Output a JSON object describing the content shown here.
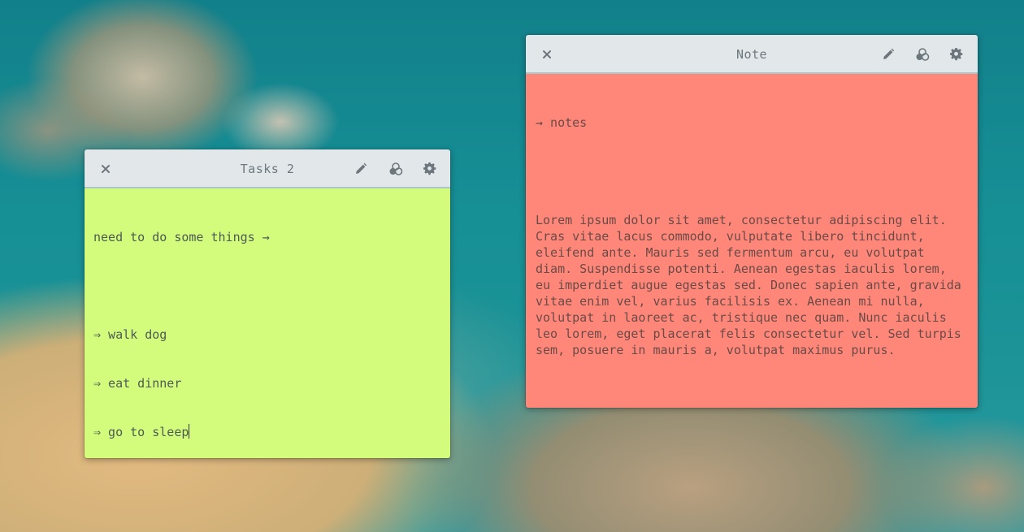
{
  "colors": {
    "titlebar": "#e2e8ea",
    "tasks_bg": "#d4fc7c",
    "note_bg": "#ff877a",
    "icon": "#6d767c"
  },
  "tasks": {
    "title": "Tasks 2",
    "icons": {
      "close": "close-icon",
      "edit": "pencil-icon",
      "color": "color-palette-icon",
      "settings": "gear-icon"
    },
    "lines": [
      "need to do some things →",
      "",
      "⇒ walk dog",
      "⇒ eat dinner",
      "⇒ go to sleep"
    ]
  },
  "note": {
    "title": "Note",
    "icons": {
      "close": "close-icon",
      "edit": "pencil-icon",
      "color": "color-palette-icon",
      "settings": "gear-icon"
    },
    "heading": "→ notes",
    "body": "Lorem ipsum dolor sit amet, consectetur adipiscing elit. Cras vitae lacus commodo, vulputate libero tincidunt, eleifend ante. Mauris sed fermentum arcu, eu volutpat diam. Suspendisse potenti. Aenean egestas iaculis lorem, eu imperdiet augue egestas sed. Donec sapien ante, gravida vitae enim vel, varius facilisis ex. Aenean mi nulla, volutpat in laoreet ac, tristique nec quam. Nunc iaculis leo lorem, eget placerat felis consectetur vel. Sed turpis sem, posuere in mauris a, volutpat maximus purus."
  }
}
